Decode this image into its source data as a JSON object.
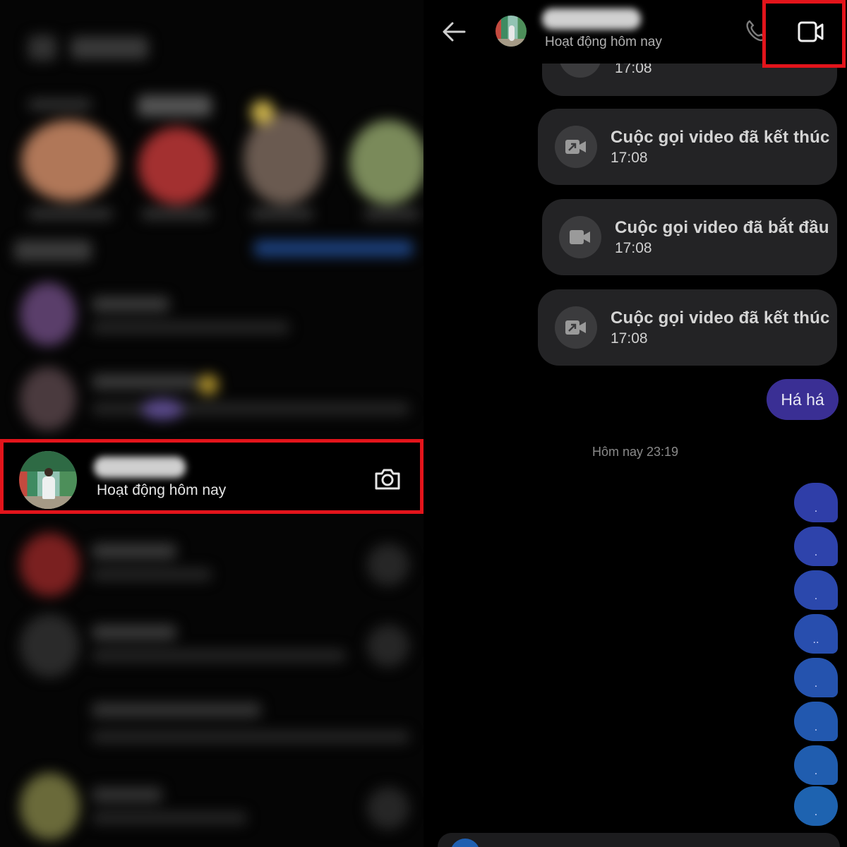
{
  "conversation_list": {
    "highlighted_contact": {
      "status": "Hoạt động hôm nay",
      "camera_icon": "camera-icon"
    }
  },
  "chat": {
    "header": {
      "back_icon": "arrow-left-icon",
      "status": "Hoạt động hôm nay",
      "phone_icon": "phone-icon",
      "video_icon": "video-camera-icon"
    },
    "partial_card_time": "17:08",
    "calls": [
      {
        "title": "Cuộc gọi video đã kết thúc",
        "time": "17:08",
        "icon": "video-call-ended-icon"
      },
      {
        "title": "Cuộc gọi video đã bắt đầu",
        "time": "17:08",
        "icon": "video-call-started-icon"
      },
      {
        "title": "Cuộc gọi video đã kết thúc",
        "time": "17:08",
        "icon": "video-call-ended-icon"
      }
    ],
    "sent_message": "Há há",
    "timestamp": "Hôm nay 23:19",
    "dot_messages": [
      ".",
      ".",
      ".",
      "..",
      ".",
      ".",
      ".",
      "."
    ],
    "colors": {
      "highlight": "#e3141b",
      "card_bg": "#232325",
      "sent_bubble": "#3a2f94",
      "dot_bubble_top": "#2f3ea8",
      "dot_bubble_bottom": "#1e63b0"
    }
  }
}
